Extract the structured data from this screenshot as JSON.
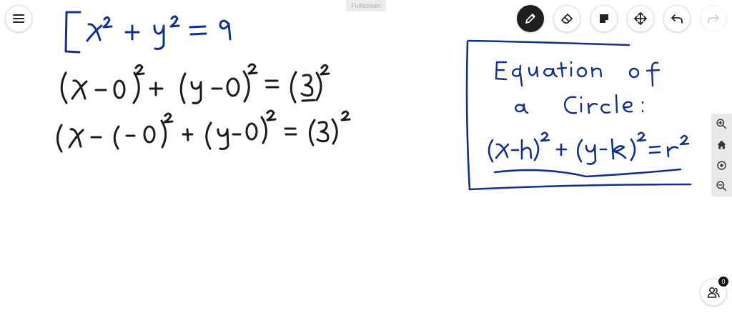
{
  "toolbar": {
    "fullscreen_label": "Fullscreen",
    "tools": [
      {
        "name": "pen",
        "active": true
      },
      {
        "name": "eraser",
        "active": false
      },
      {
        "name": "sticky-note",
        "active": false
      },
      {
        "name": "move",
        "active": false
      },
      {
        "name": "undo",
        "active": false
      },
      {
        "name": "redo",
        "active": false,
        "disabled": true
      }
    ]
  },
  "zoom_controls": [
    "zoom-in",
    "home",
    "reset-view",
    "zoom-out"
  ],
  "participants": {
    "count": "0"
  },
  "colors": {
    "black_ink": "#1c1c1c",
    "blue_ink": "#13308f",
    "active_tool": "#1f1f1f"
  }
}
